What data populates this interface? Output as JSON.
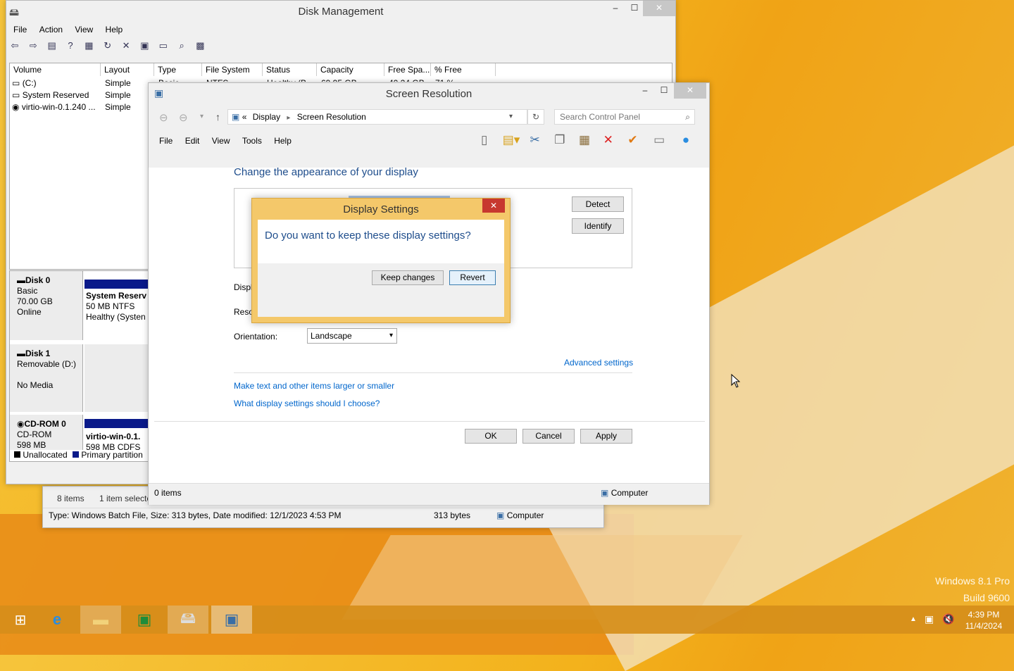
{
  "desktop": {
    "watermark_line1": "Windows 8.1 Pro",
    "watermark_line2": "Build 9600"
  },
  "disk_mgmt": {
    "title": "Disk Management",
    "menu": [
      "File",
      "Action",
      "View",
      "Help"
    ],
    "columns": [
      "Volume",
      "Layout",
      "Type",
      "File System",
      "Status",
      "Capacity",
      "Free Spa...",
      "% Free"
    ],
    "volumes": [
      {
        "name": "(C:)",
        "layout": "Simple",
        "type": "Basic",
        "fs": "NTFS",
        "status": "Healthy (B...",
        "capacity": "69.95 GB",
        "free": "40.24 GB",
        "pct": "71 %"
      },
      {
        "name": "System Reserved",
        "layout": "Simple"
      },
      {
        "name": "virtio-win-0.1.240 ...",
        "layout": "Simple"
      }
    ],
    "disks": [
      {
        "label": "Disk 0",
        "l2": "Basic",
        "l3": "70.00 GB",
        "l4": "Online",
        "part_name": "System Reserv",
        "part_l2": "50 MB NTFS",
        "part_l3": "Healthy (Systen"
      },
      {
        "label": "Disk 1",
        "l2": "Removable (D:)",
        "l3": "",
        "l4": "No Media"
      },
      {
        "label": "CD-ROM 0",
        "l2": "CD-ROM",
        "l3": "598 MB",
        "part_name": "virtio-win-0.1.",
        "part_l2": "598 MB CDFS"
      }
    ],
    "legend_unallocated": "Unallocated",
    "legend_primary": "Primary partition"
  },
  "explorer_status": {
    "items": "8 items",
    "selected": "1 item selecte",
    "details": "Type: Windows Batch File, Size: 313 bytes, Date modified: 12/1/2023 4:53 PM",
    "size": "313 bytes",
    "location": "Computer"
  },
  "screen_res": {
    "title": "Screen Resolution",
    "breadcrumb_prefix": "«",
    "breadcrumb_1": "Display",
    "breadcrumb_2": "Screen Resolution",
    "search_placeholder": "Search Control Panel",
    "menu": [
      "File",
      "Edit",
      "View",
      "Tools",
      "Help"
    ],
    "heading": "Change the appearance of your display",
    "detect": "Detect",
    "identify": "Identify",
    "display_label": "Displ",
    "resolution_label": "Reso",
    "orientation_label": "Orientation:",
    "orientation_value": "Landscape",
    "advanced": "Advanced settings",
    "link1": "Make text and other items larger or smaller",
    "link2": "What display settings should I choose?",
    "ok": "OK",
    "cancel": "Cancel",
    "apply": "Apply",
    "status_items": "0 items",
    "status_location": "Computer"
  },
  "dialog": {
    "title": "Display Settings",
    "question": "Do you want to keep these display settings?",
    "keep": "Keep changes",
    "revert": "Revert",
    "close": "✕"
  },
  "taskbar": {
    "time": "4:39 PM",
    "date": "11/4/2024"
  }
}
